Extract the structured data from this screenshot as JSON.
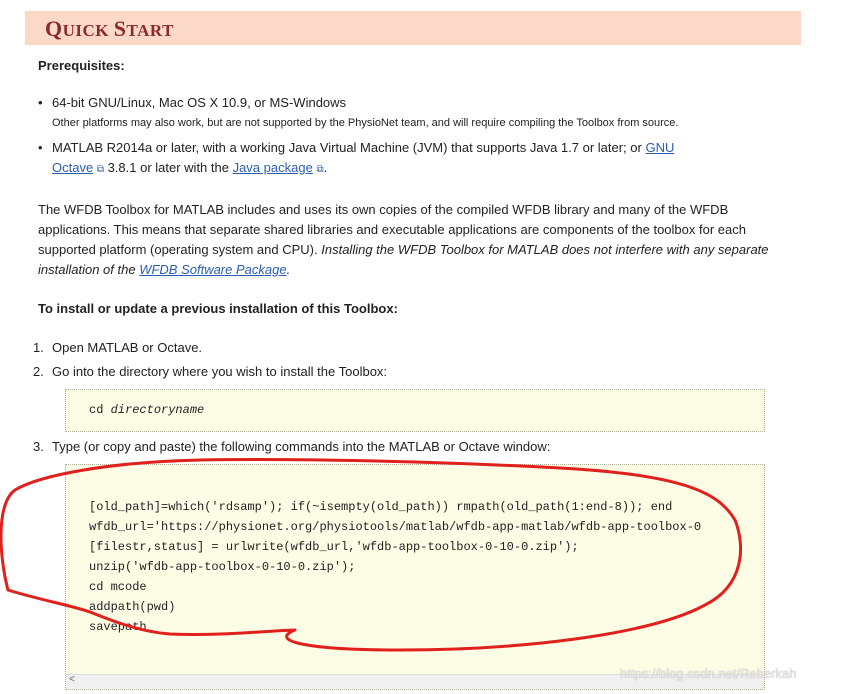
{
  "header": {
    "title_first_big": "Q",
    "title_first_rest": "UICK ",
    "title_second_big": "S",
    "title_second_rest": "TART"
  },
  "prereq": {
    "heading": "Prerequisites:",
    "items": [
      {
        "main": "64-bit GNU/Linux, Mac OS X 10.9, or MS-Windows",
        "note": "Other platforms may also work, but are not supported by the PhysioNet team, and will require compiling the Toolbox from source."
      },
      {
        "main_pre": "MATLAB R2014a or later, with a working Java Virtual Machine (JVM) that supports Java 1.7 or later; or ",
        "link1_a": "GNU",
        "link1_b": "Octave",
        "mid": " 3.8.1 or later with the ",
        "link2": "Java package",
        "end": "."
      }
    ]
  },
  "paragraph": {
    "normal": "The WFDB Toolbox for MATLAB includes and uses its own copies of the compiled WFDB library and many of the WFDB applications. This means that separate shared libraries and executable applications are components of the toolbox for each supported platform (operating system and CPU). ",
    "italic_pre": "Installing the WFDB Toolbox for MATLAB does not interfere with any separate installation of the ",
    "italic_link": "WFDB Software Package",
    "italic_end": "."
  },
  "install": {
    "heading": "To install or update a previous installation of this Toolbox:",
    "steps": [
      {
        "num": "1.",
        "text": "Open MATLAB or Octave."
      },
      {
        "num": "2.",
        "text": "Go into the directory where you wish to install the Toolbox:"
      },
      {
        "num": "3.",
        "text": "Type (or copy and paste) the following commands into the MATLAB or Octave window:"
      }
    ],
    "code1_cmd": "cd ",
    "code1_arg": "directoryname",
    "code2_lines": [
      "[old_path]=which('rdsamp'); if(~isempty(old_path)) rmpath(old_path(1:end-8)); end",
      "wfdb_url='https://physionet.org/physiotools/matlab/wfdb-app-matlab/wfdb-app-toolbox-0",
      "[filestr,status] = urlwrite(wfdb_url,'wfdb-app-toolbox-0-10-0.zip');",
      "unzip('wfdb-app-toolbox-0-10-0.zip');",
      "cd mcode",
      "addpath(pwd)",
      "savepath"
    ]
  },
  "scrollbar": {
    "left_arrow": "<"
  },
  "watermark": "https://blog.csdn.net/Reberkah",
  "colors": {
    "header_bg": "#fcd8c8",
    "header_text": "#8b2a2a",
    "code_bg": "#fdfde6",
    "link": "#2a5db0",
    "annotation": "#e0201c"
  }
}
